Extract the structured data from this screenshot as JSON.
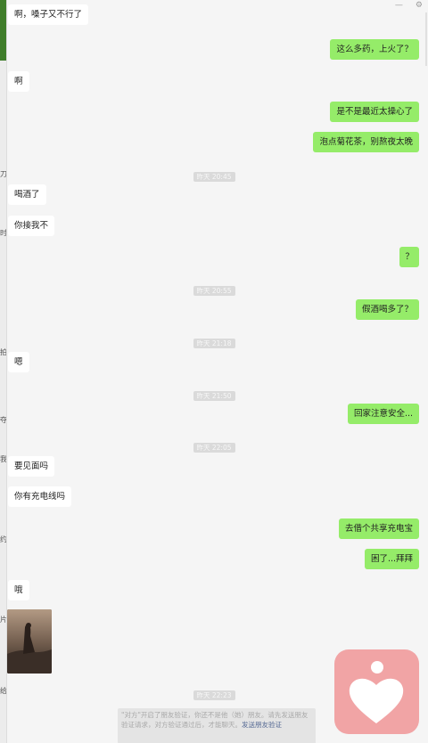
{
  "window": {
    "minimize_icon": "minimize-icon",
    "settings_icon": "gear-icon",
    "minimize_glyph": "—",
    "settings_glyph": "⚙"
  },
  "left_strip_glyphs": [
    "刀",
    "时",
    "拍",
    "夺",
    "我",
    "约",
    "片",
    "给"
  ],
  "messages": [
    {
      "dir": "in",
      "text": "啊，嗓子又不行了"
    },
    {
      "dir": "out",
      "text": "这么多药，上火了？"
    },
    {
      "dir": "in",
      "text": "啊"
    },
    {
      "dir": "out",
      "text": "是不是最近太操心了"
    },
    {
      "dir": "out",
      "text": "泡点菊花茶，别熬夜太晚"
    },
    {
      "dir": "time",
      "text": "昨天 20:45"
    },
    {
      "dir": "in",
      "text": "喝酒了"
    },
    {
      "dir": "in",
      "text": "你接我不"
    },
    {
      "dir": "out",
      "text": "？"
    },
    {
      "dir": "time",
      "text": "昨天 20:55"
    },
    {
      "dir": "out",
      "text": "假酒喝多了？"
    },
    {
      "dir": "time",
      "text": "昨天 21:18"
    },
    {
      "dir": "in",
      "text": "嗯"
    },
    {
      "dir": "time",
      "text": "昨天 21:50"
    },
    {
      "dir": "out",
      "text": "回家注意安全..."
    },
    {
      "dir": "time",
      "text": "昨天 22:05"
    },
    {
      "dir": "in",
      "text": "要见面吗"
    },
    {
      "dir": "in",
      "text": "你有充电线吗"
    },
    {
      "dir": "out",
      "text": "去借个共享充电宝"
    },
    {
      "dir": "out",
      "text": "困了...拜拜"
    },
    {
      "dir": "in",
      "text": "哦"
    },
    {
      "dir": "time",
      "text": "昨天 22:23"
    }
  ],
  "notice": {
    "text": "\"对方\"开启了朋友验证，你还不是他（她）朋友。请先发送朋友验证请求，对方验证通过后，才能聊天。",
    "link": "发送朋友验证"
  },
  "colors": {
    "out_bubble": "#95ec69",
    "in_bubble": "#ffffff",
    "background": "#f5f5f5",
    "heart_app": "#f1a4a5"
  }
}
